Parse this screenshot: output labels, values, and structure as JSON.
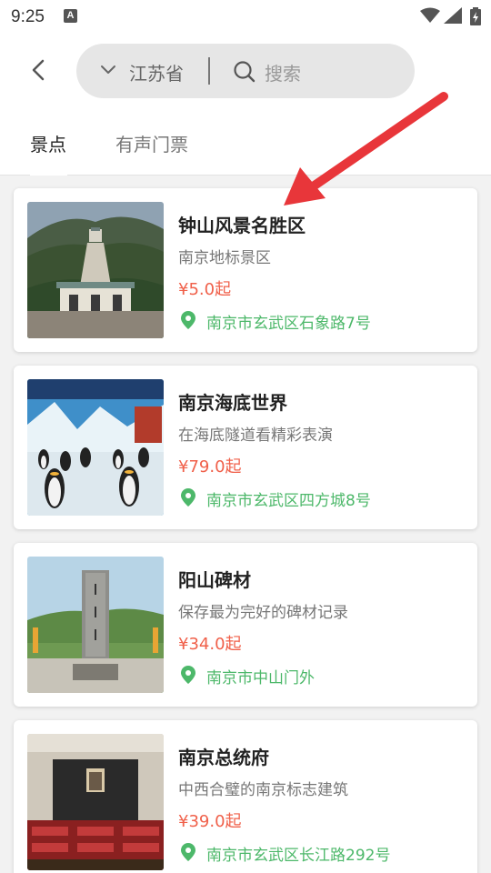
{
  "status": {
    "time": "9:25",
    "notif_letter": "A"
  },
  "header": {
    "province": "江苏省",
    "search_placeholder": "搜索",
    "tabs": [
      {
        "label": "景点",
        "active": true
      },
      {
        "label": "有声门票",
        "active": false
      }
    ]
  },
  "colors": {
    "price": "#f0604a",
    "address": "#4db86a",
    "arrow": "#e8363a"
  },
  "spots": [
    {
      "name": "钟山风景名胜区",
      "desc": "南京地标景区",
      "price": "¥5.0起",
      "address": "南京市玄武区石象路7号"
    },
    {
      "name": "南京海底世界",
      "desc": "在海底隧道看精彩表演",
      "price": "¥79.0起",
      "address": "南京市玄武区四方城8号"
    },
    {
      "name": "阳山碑材",
      "desc": "保存最为完好的碑材记录",
      "price": "¥34.0起",
      "address": "南京市中山门外"
    },
    {
      "name": "南京总统府",
      "desc": "中西合璧的南京标志建筑",
      "price": "¥39.0起",
      "address": "南京市玄武区长江路292号"
    }
  ]
}
